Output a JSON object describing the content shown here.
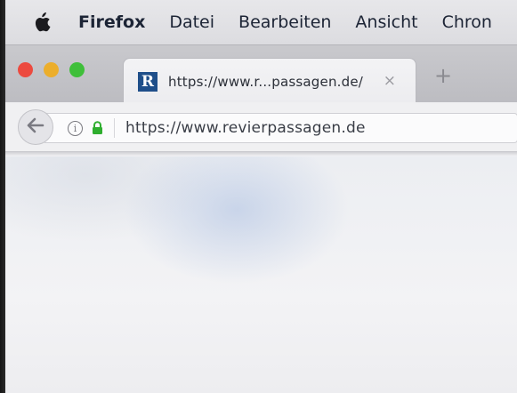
{
  "menubar": {
    "apple_icon": "apple-logo-icon",
    "items": [
      "Firefox",
      "Datei",
      "Bearbeiten",
      "Ansicht",
      "Chron"
    ]
  },
  "window_controls": {
    "close_color": "#ec4a3f",
    "minimize_color": "#ecae2c",
    "zoom_color": "#3fbf3a"
  },
  "tab": {
    "favicon_letter": "R",
    "title": "https://www.r...passagen.de/",
    "close_icon": "×",
    "new_tab_icon": "+"
  },
  "toolbar": {
    "back_icon": "arrow-left-icon",
    "info_icon": "i",
    "url": "https://www.revierpassagen.de"
  },
  "colors": {
    "secure_lock": "#2fae2f",
    "favicon_bg": "#1f4f8a"
  }
}
